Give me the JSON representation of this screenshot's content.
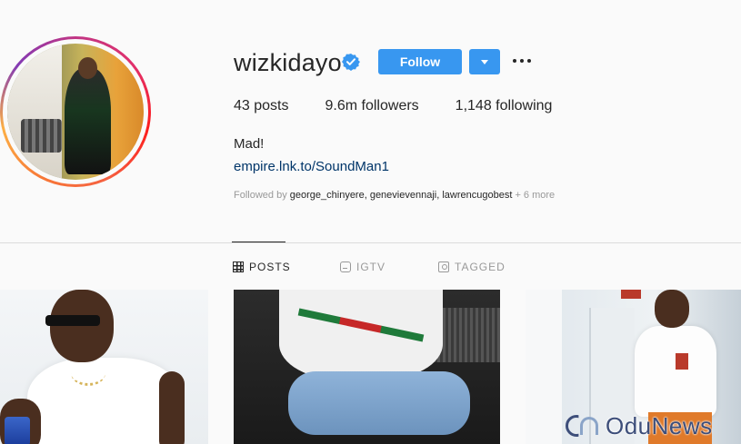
{
  "profile": {
    "username": "wizkidayo",
    "verified_icon": "verified-badge-icon",
    "follow_label": "Follow",
    "dropdown_icon": "chevron-down-icon",
    "more_icon": "more-options-icon"
  },
  "stats": {
    "posts_count": "43",
    "posts_label": "posts",
    "followers_count": "9.6m",
    "followers_label": "followers",
    "following_count": "1,148",
    "following_label": "following"
  },
  "bio": {
    "name_text": "Mad!",
    "link": "empire.lnk.to/SoundMan1",
    "followed_by_prefix": "Followed by ",
    "followed_by_names": "george_chinyere, genevievennaji, lawrencugobest",
    "followed_by_more": " + 6 more"
  },
  "tabs": [
    {
      "label": "POSTS",
      "icon": "grid-icon",
      "active": true
    },
    {
      "label": "IGTV",
      "icon": "tv-icon",
      "active": false
    },
    {
      "label": "TAGGED",
      "icon": "tag-person-icon",
      "active": false
    }
  ],
  "colors": {
    "accent": "#3897f0",
    "link": "#003569",
    "text": "#262626",
    "muted": "#999999",
    "background": "#fafafa"
  },
  "watermark": {
    "text": "OduNews"
  }
}
